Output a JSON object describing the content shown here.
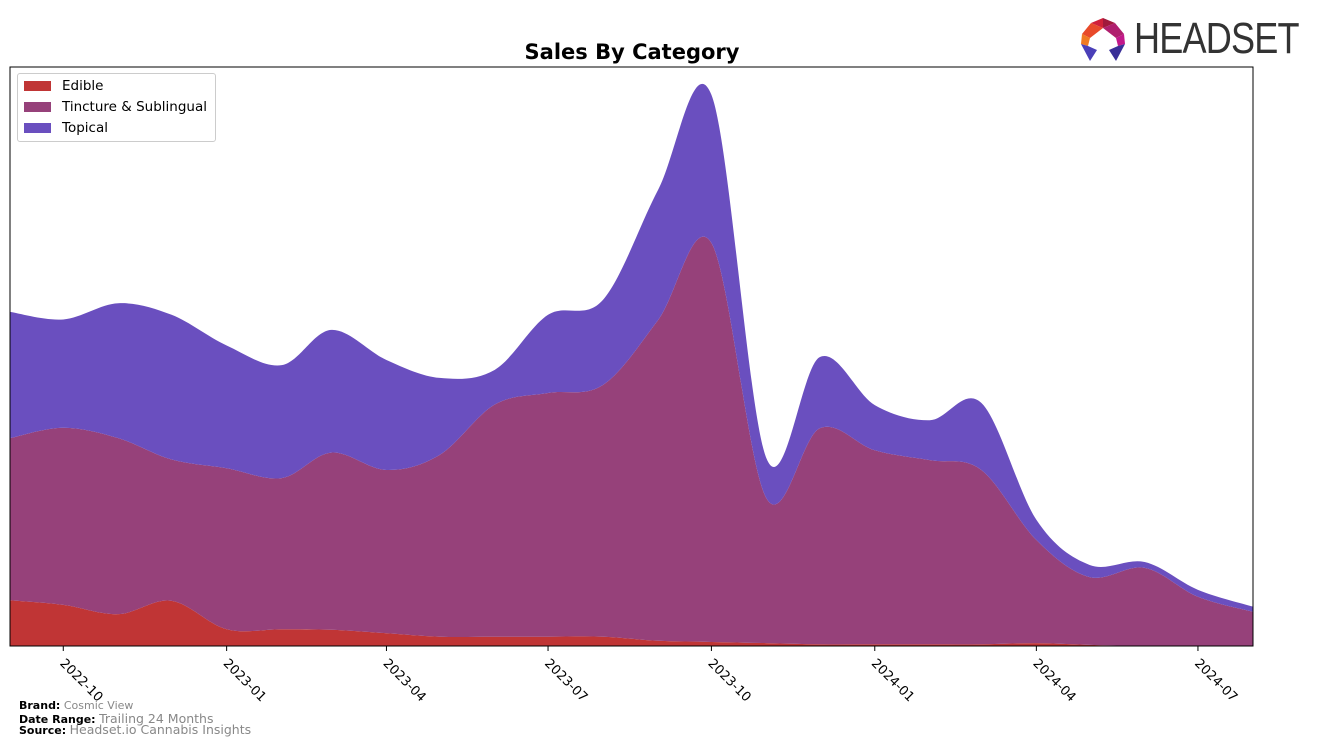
{
  "chart_data": {
    "type": "area",
    "stacked": true,
    "smoothed": true,
    "title": "Sales By Category",
    "xlabel": "",
    "ylabel": "",
    "ylim": [
      0,
      100
    ],
    "y_ticks_shown": false,
    "grid": false,
    "legend_placement": "top-left",
    "x": [
      "2022-09",
      "2022-10",
      "2022-11",
      "2022-12",
      "2023-01",
      "2023-02",
      "2023-03",
      "2023-04",
      "2023-05",
      "2023-06",
      "2023-07",
      "2023-08",
      "2023-09",
      "2023-10",
      "2023-11",
      "2023-12",
      "2024-01",
      "2024-02",
      "2024-03",
      "2024-04",
      "2024-05",
      "2024-06",
      "2024-07",
      "2024-08"
    ],
    "x_tick_labels": [
      "2022-10",
      "2023-01",
      "2023-04",
      "2023-07",
      "2023-10",
      "2024-01",
      "2024-04",
      "2024-07"
    ],
    "series": [
      {
        "name": "Edible",
        "color": "#c03535",
        "values": [
          7.9,
          7.1,
          5.5,
          7.8,
          2.9,
          2.9,
          2.8,
          2.2,
          1.6,
          1.6,
          1.6,
          1.6,
          0.9,
          0.7,
          0.5,
          0.3,
          0.3,
          0.3,
          0.3,
          0.5,
          0.2,
          0,
          0,
          0
        ]
      },
      {
        "name": "Tincture & Sublingual",
        "color": "#96417a",
        "values": [
          28.0,
          30.6,
          30.4,
          24.4,
          27.8,
          26.1,
          30.6,
          28.2,
          31.4,
          40.1,
          42.1,
          43.5,
          55.4,
          68.9,
          25.0,
          37.3,
          33.5,
          31.8,
          30.1,
          17.8,
          11.7,
          13.5,
          8.5,
          5.9
        ]
      },
      {
        "name": "Topical",
        "color": "#6a4fbf",
        "values": [
          21.8,
          18.7,
          23.3,
          25.0,
          21.2,
          19.5,
          21.2,
          19.0,
          13.3,
          6.0,
          13.5,
          14.7,
          22.5,
          25.6,
          6.9,
          12.3,
          7.8,
          6.9,
          11.6,
          3.5,
          2.1,
          1.0,
          1.2,
          0.9
        ]
      }
    ]
  },
  "footer": {
    "brand_label": "Brand:",
    "brand_value": "Cosmic View",
    "date_range_label": "Date Range:",
    "date_range_value": "Trailing 24 Months",
    "source_label": "Source:",
    "source_value": "Headset.io Cannabis Insights"
  },
  "logo": {
    "text": "HEADSET"
  }
}
